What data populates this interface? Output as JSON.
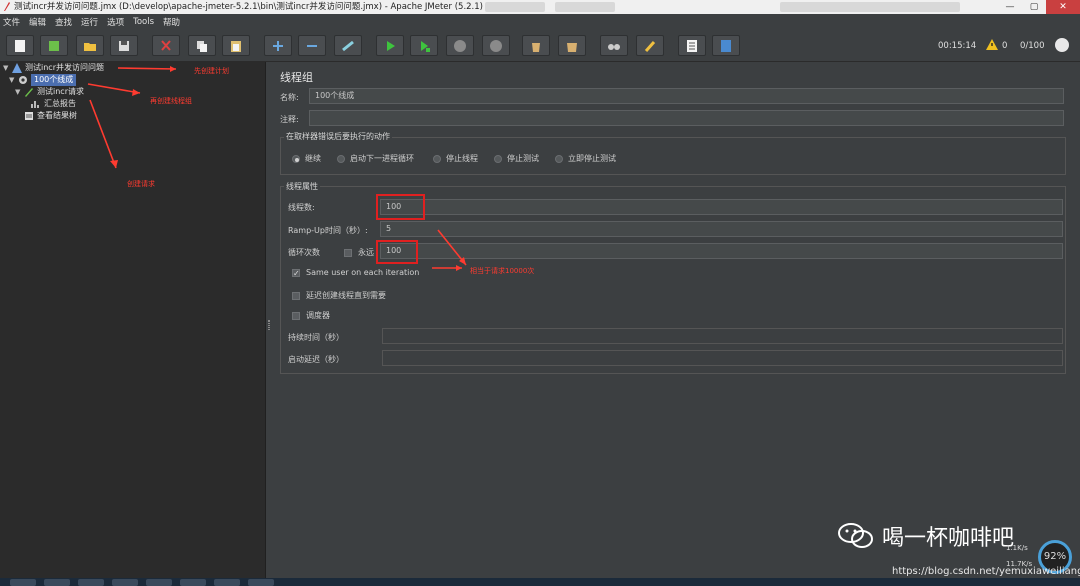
{
  "window": {
    "title": "测试incr并发访问问题.jmx (D:\\develop\\apache-jmeter-5.2.1\\bin\\测试incr并发访问问题.jmx) - Apache JMeter (5.2.1)",
    "minimize": "—",
    "maximize": "▢",
    "close": "✕"
  },
  "menu": [
    "文件",
    "编辑",
    "查找",
    "运行",
    "选项",
    "Tools",
    "帮助"
  ],
  "toolbar": {
    "icons": [
      "new-icon",
      "templates-icon",
      "open-icon",
      "save-icon",
      "cut-icon",
      "copy-icon",
      "paste-icon",
      "expand-icon",
      "collapse-icon",
      "toggle-icon",
      "start-icon",
      "start-no-pause-icon",
      "stop-icon",
      "shutdown-icon",
      "clear-icon",
      "clear-all-icon",
      "search-icon",
      "reset-search-icon",
      "function-helper-icon",
      "help-icon"
    ],
    "elapsed": "00:15:14",
    "warnings": "0",
    "threads": "0/100"
  },
  "tree": {
    "test_plan": "测试incr并发访问问题",
    "thread_group": "100个线成",
    "request": "测试incr请求",
    "summary_report": "汇总报告",
    "results_tree": "查看结果树"
  },
  "annotations": {
    "create_plan": "先创建计划",
    "create_group": "再创建线程组",
    "create_request": "创建请求",
    "equals": "相当于请求10000次"
  },
  "panel": {
    "title": "线程组",
    "name_label": "名称:",
    "name_value": "100个线成",
    "comment_label": "注释:",
    "comment_value": "",
    "error_group_title": "在取样器错误后要执行的动作",
    "error_actions": [
      "继续",
      "启动下一进程循环",
      "停止线程",
      "停止测试",
      "立即停止测试"
    ],
    "thread_props_title": "线程属性",
    "threads_label": "线程数:",
    "threads_value": "100",
    "rampup_label": "Ramp-Up时间（秒）:",
    "rampup_value": "5",
    "loop_label": "循环次数",
    "forever_label": "永远",
    "loop_value": "100",
    "same_user_label": "Same user on each iteration",
    "delay_label": "延迟创建线程直到需要",
    "scheduler_label": "调度器",
    "duration_label": "持续时间（秒）",
    "duration_value": "",
    "startup_delay_label": "启动延迟（秒）",
    "startup_delay_value": ""
  },
  "overlay": {
    "watermark": "喝一杯咖啡吧",
    "csdn": "https://blog.csdn.net/yemuxiaweiliang",
    "percent": "92%",
    "up_rate": "1.1K/s",
    "down_rate": "11.7K/s"
  },
  "colors": {
    "accent": "#4b6eaf",
    "annotation": "#ff3b30",
    "background": "#3c3f41"
  }
}
